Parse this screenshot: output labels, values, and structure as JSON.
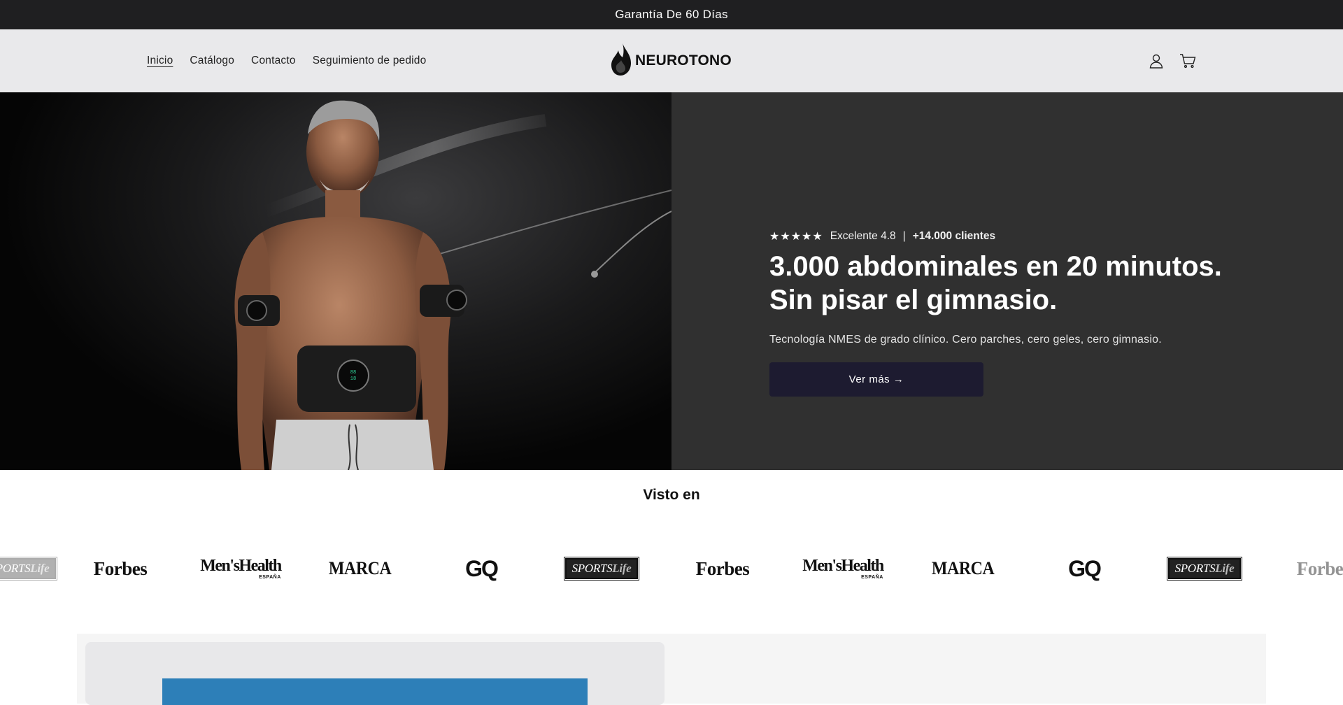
{
  "announcement": {
    "text": "Garantía De 60 Días"
  },
  "nav": {
    "items": [
      {
        "label": "Inicio",
        "active": true
      },
      {
        "label": "Catálogo"
      },
      {
        "label": "Contacto"
      },
      {
        "label": "Seguimiento de pedido"
      }
    ]
  },
  "brand": {
    "name": "NEUROTONO"
  },
  "header_icons": [
    "user-icon",
    "cart-icon"
  ],
  "hero": {
    "rating": {
      "stars": "★★★★★",
      "stars_value": 4.8,
      "text": "Excelente 4.8",
      "separator": "|",
      "customers": "+14.000 clientes"
    },
    "headline": "3.000 abdominales en 20 minutos. Sin pisar el gimnasio.",
    "subtitle": "Tecnología NMES de grado clínico. Cero parches, cero geles, cero gimnasio.",
    "cta_label": "Ver más →"
  },
  "press": {
    "title": "Visto en",
    "logos": [
      {
        "name": "Sports Life",
        "t1": "SPORTS",
        "t2": "Life"
      },
      {
        "name": "Forbes"
      },
      {
        "name": "Men'sHealth",
        "sub": "ESPAÑA"
      },
      {
        "name": "MARCA"
      },
      {
        "name": "GQ"
      },
      {
        "name": "Sports Life",
        "t1": "SPORTS",
        "t2": "Life"
      },
      {
        "name": "Forbes"
      },
      {
        "name": "Men'sHealth",
        "sub": "ESPAÑA"
      },
      {
        "name": "MARCA"
      },
      {
        "name": "GQ"
      },
      {
        "name": "Sports Life",
        "t1": "SPORTS",
        "t2": "Life"
      },
      {
        "name": "Forbes"
      }
    ]
  },
  "colors": {
    "announcement_bg": "#1f1f21",
    "header_bg": "#e9e9eb",
    "hero_content_bg": "#303030",
    "cta_bg": "#1d1b30",
    "section_blue": "#2d7fb8"
  }
}
